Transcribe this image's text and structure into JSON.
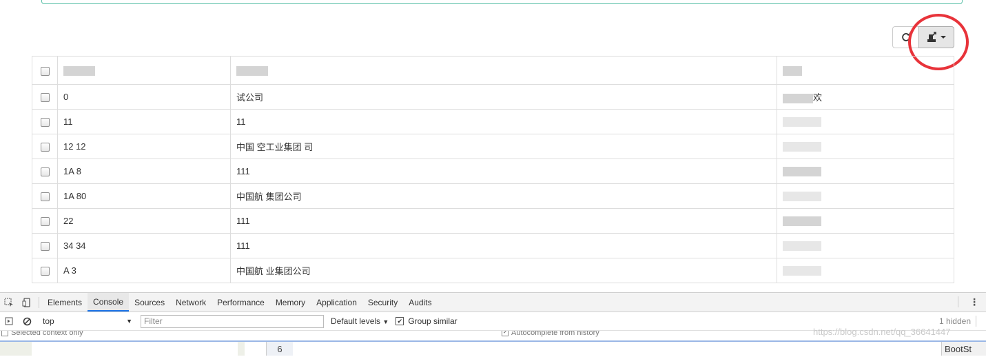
{
  "toolbar": {
    "refresh_icon": "refresh-icon",
    "export_icon": "export-icon"
  },
  "table": {
    "rows": [
      {
        "code": "0",
        "name": "试公司",
        "extra": "欢"
      },
      {
        "code": "11",
        "name": "11",
        "extra": ""
      },
      {
        "code": "12 12",
        "name": "中国 空工业集团 司",
        "extra": ""
      },
      {
        "code": "1A 8",
        "name": "111",
        "extra": ""
      },
      {
        "code": "1A 80",
        "name": "中国航 集团公司",
        "extra": ""
      },
      {
        "code": "22",
        "name": "111",
        "extra": ""
      },
      {
        "code": "34 34",
        "name": "111",
        "extra": ""
      },
      {
        "code": "A 3",
        "name": "中国航 业集团公司",
        "extra": ""
      }
    ]
  },
  "devtools": {
    "tabs": [
      "Elements",
      "Console",
      "Sources",
      "Network",
      "Performance",
      "Memory",
      "Application",
      "Security",
      "Audits"
    ],
    "active_tab": "Console",
    "context": "top",
    "filter_placeholder": "Filter",
    "levels": "Default levels",
    "group_similar": "Group similar",
    "hidden_count": "1 hidden",
    "opt_selected_context": "Selected context only",
    "opt_autocomplete": "Autocomplete from history",
    "line_number": "6",
    "bottom_right": "BootSt",
    "watermark": "https://blog.csdn.net/qq_36641447"
  }
}
